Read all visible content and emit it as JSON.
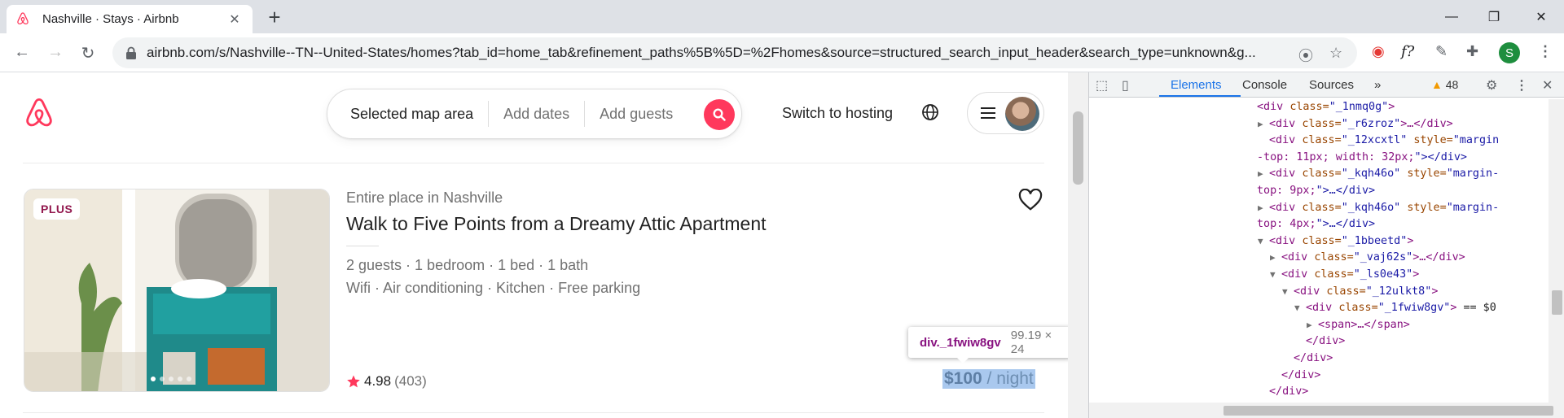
{
  "browser": {
    "tab_title": "Nashville · Stays · Airbnb",
    "tab_close": "✕",
    "new_tab": "+",
    "url": "airbnb.com/s/Nashville--TN--United-States/homes?tab_id=home_tab&refinement_paths%5B%5D=%2Fhomes&source=structured_search_input_header&search_type=unknown&g...",
    "profile_initial": "S",
    "ext_f": "f?"
  },
  "header": {
    "search_location": "Selected map area",
    "search_dates": "Add dates",
    "search_guests": "Add guests",
    "switch_hosting": "Switch to hosting"
  },
  "listing": {
    "badge": "PLUS",
    "subtitle": "Entire place in Nashville",
    "title": "Walk to Five Points from a Dreamy Attic Apartment",
    "specs": "2 guests · 1 bedroom · 1 bed · 1 bath",
    "amenities": "Wifi · Air conditioning · Kitchen · Free parking",
    "rating": "4.98",
    "review_count": "(403)",
    "price": "$100",
    "price_unit": " / night"
  },
  "tooltip": {
    "tag": "div._1fwiw8gv",
    "size": "99.19 × 24"
  },
  "devtools": {
    "tabs": [
      "Elements",
      "Console",
      "Sources"
    ],
    "more": "»",
    "warnings": "48",
    "dom_lines": [
      {
        "indent": 0,
        "tri": "",
        "tag": "<div class=\"_1nmq0g\">",
        "sel": false
      },
      {
        "indent": 1,
        "tri": "▶",
        "tag": "<div class=\"_r6zroz\">…</div>",
        "sel": false
      },
      {
        "indent": 1,
        "tri": "",
        "tag": "<div class=\"_12xcxtl\" style=\"margin",
        "sel": false
      },
      {
        "indent": 0,
        "tri": "",
        "tag": "-top: 11px; width: 32px;\"></div>",
        "sel": false,
        "cont": true
      },
      {
        "indent": 1,
        "tri": "▶",
        "tag": "<div class=\"_kqh46o\" style=\"margin-",
        "sel": false
      },
      {
        "indent": 0,
        "tri": "",
        "tag": "top: 9px;\">…</div>",
        "sel": false,
        "cont": true
      },
      {
        "indent": 1,
        "tri": "▶",
        "tag": "<div class=\"_kqh46o\" style=\"margin-",
        "sel": false
      },
      {
        "indent": 0,
        "tri": "",
        "tag": "top: 4px;\">…</div>",
        "sel": false,
        "cont": true
      },
      {
        "indent": 1,
        "tri": "▼",
        "tag": "<div class=\"_1bbeetd\">",
        "sel": false
      },
      {
        "indent": 2,
        "tri": "▶",
        "tag": "<div class=\"_vaj62s\">…</div>",
        "sel": false
      },
      {
        "indent": 2,
        "tri": "▼",
        "tag": "<div class=\"_ls0e43\">",
        "sel": false
      },
      {
        "indent": 3,
        "tri": "▼",
        "tag": "<div class=\"_12ulkt8\">",
        "sel": false
      },
      {
        "indent": 4,
        "tri": "▼",
        "tag": "<div class=\"_1fwiw8gv\"> == $0",
        "sel": true
      },
      {
        "indent": 5,
        "tri": "▶",
        "tag": "<span>…</span>",
        "sel": false
      },
      {
        "indent": 4,
        "tri": "",
        "tag": "</div>",
        "sel": false
      },
      {
        "indent": 3,
        "tri": "",
        "tag": "</div>",
        "sel": false
      },
      {
        "indent": 2,
        "tri": "",
        "tag": "</div>",
        "sel": false
      },
      {
        "indent": 1,
        "tri": "",
        "tag": "</div>",
        "sel": false
      }
    ]
  },
  "colors": {
    "brand": "#ff385c",
    "plus_badge": "#92174d",
    "devtools_accent": "#1a73e8",
    "selection": "#a9c8ee"
  }
}
